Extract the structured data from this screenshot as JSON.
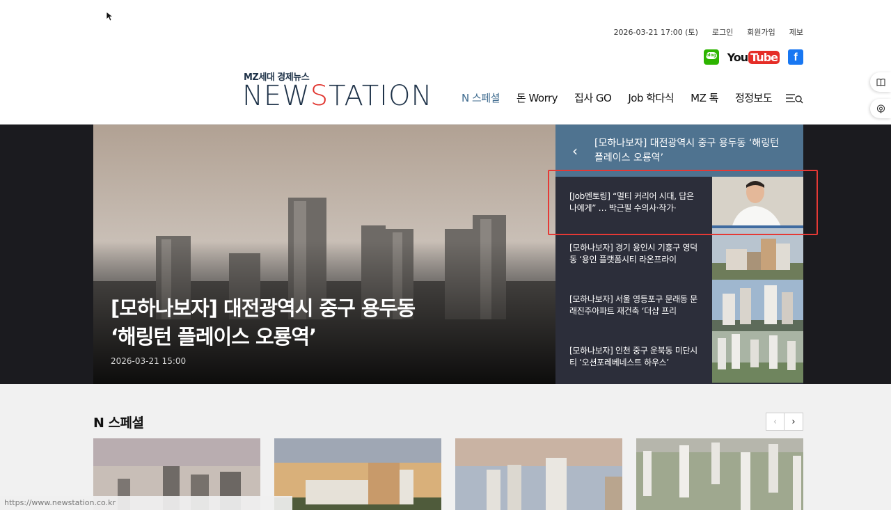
{
  "top": {
    "datetime": "2026-03-21 17:00 (토)",
    "login": "로그인",
    "signup": "회원가입",
    "report": "제보"
  },
  "social": {
    "blog": "blog",
    "youtube_you": "You",
    "youtube_tube": "Tube",
    "facebook": "f"
  },
  "logo": {
    "subtitle": "MZ세대 경제뉴스",
    "word_a": "NEW",
    "word_b": "S",
    "word_c": "TATION"
  },
  "nav": {
    "items": [
      "N 스페셜",
      "돈 Worry",
      "집사 GO",
      "Job 학다식",
      "MZ 톡",
      "정정보도"
    ]
  },
  "hero": {
    "title_line1": "[모하나보자] 대전광역시 중구 용두동",
    "title_line2": "‘해링턴 플레이스 오룡역’",
    "date": "2026-03-21 15:00",
    "side_head": "[모하나보자] 대전광역시 중구 용두동 ‘해링턴 플레이스 오룡역’",
    "side_items": [
      {
        "title": "[Job멘토링] “멀티 커리어 시대, 답은 나에게” … 박근필 수의사·작가·"
      },
      {
        "title": "[모하나보자] 경기 용인시 기흥구 영덕동 ‘용인 플랫폼시티 라온프라이"
      },
      {
        "title": "[모하나보자] 서울 영등포구 문래동 문래진주아파트 재건축 ‘더샵 프리"
      },
      {
        "title": "[모하나보자] 인천 중구 운북동 미단시티 ‘오션포레베네스트 하우스’"
      }
    ]
  },
  "section": {
    "title": "N 스페셜",
    "prev": "‹",
    "next": "›"
  },
  "status_url": "https://www.newstation.co.kr"
}
